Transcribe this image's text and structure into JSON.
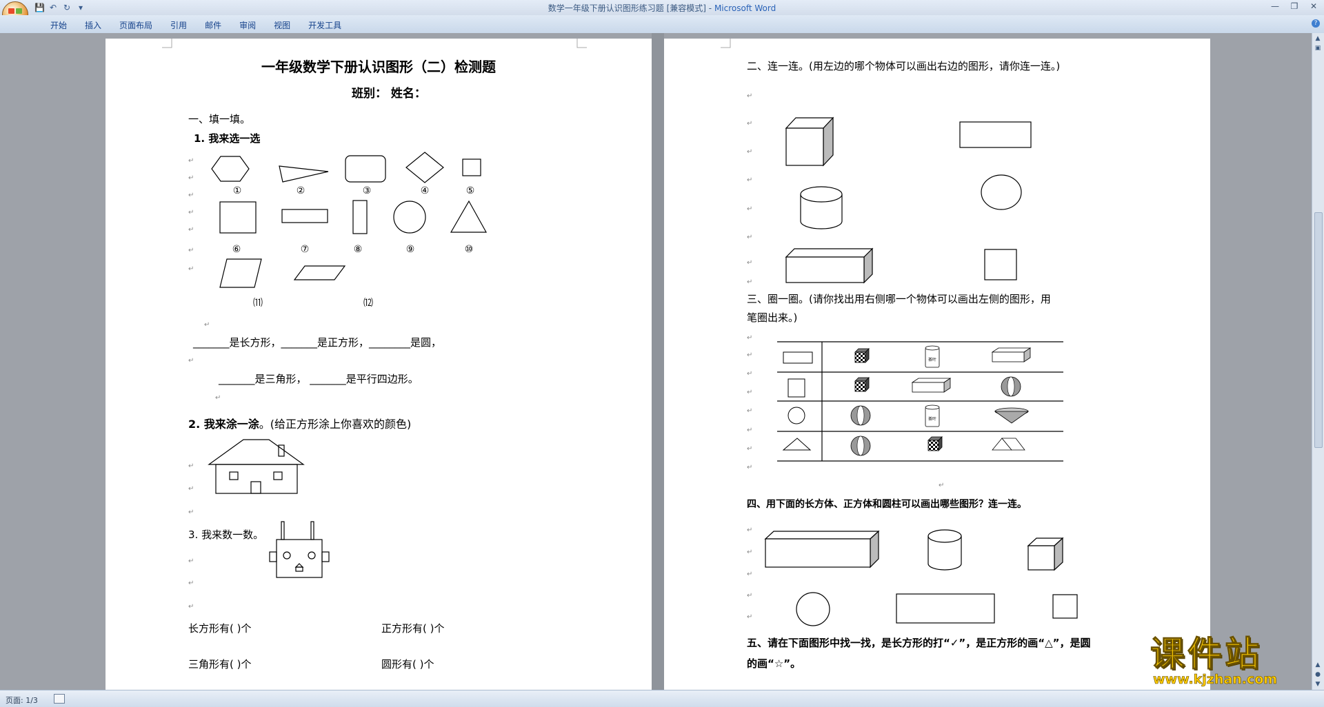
{
  "window": {
    "title_doc": "数学一年级下册认识图形练习题 [兼容模式]",
    "title_sep": " - ",
    "title_app": "Microsoft Word"
  },
  "quick_access": {
    "save_icon": "save-icon",
    "undo_icon": "undo-icon",
    "redo_icon": "redo-icon",
    "customize_icon": "customize-qat-icon"
  },
  "ribbon": {
    "tabs": [
      "开始",
      "插入",
      "页面布局",
      "引用",
      "邮件",
      "审阅",
      "视图",
      "开发工具"
    ]
  },
  "status": {
    "page": "页面: 1/3"
  },
  "watermark": {
    "brand": "课件站",
    "url": "www.kjzhan.com"
  },
  "doc": {
    "p1": {
      "title": "一年级数学下册认识图形（二）检测题",
      "subtitle": "班别：        姓名：",
      "s1": "一、填一填。",
      "q1": "1. 我来选一选",
      "labels_row1": [
        "①",
        "②",
        "③",
        "④",
        "⑤"
      ],
      "labels_row2": [
        "⑥",
        "⑦",
        "⑧",
        "⑨",
        "⑩"
      ],
      "labels_row3": [
        "⑾",
        "⑿"
      ],
      "fill1": "_______是长方形，_______是正方形，________是圆，",
      "fill2": "_______是三角形，     _______是平行四边形。",
      "q2_bold": "2. 我来涂一涂",
      "q2_rest": "。(给正方形涂上你喜欢的颜色)",
      "q3": "3. 我来数一数。",
      "count1a": "长方形有(          )个",
      "count1b": "正方形有(         )个",
      "count2a": "三角形有(          )个",
      "count2b": "圆形有(         )个"
    },
    "p2": {
      "s2": "二、连一连。(用左边的哪个物体可以画出右边的图形，请你连一连。)",
      "s3a": "三、圈一圈。(请你找出用右侧哪一个物体可以画出左侧的图形，用",
      "s3b": "笔圈出来。)",
      "can_text": "茶叶",
      "s4": "四、用下面的长方体、正方体和圆柱可以画出哪些图形？连一连。",
      "s5a": "五、请在下面图形中找一找，是长方形的打“✓”，是正方形的画“△”，是圆",
      "s5b": "的画“☆”。"
    },
    "para_mark": "↵"
  }
}
